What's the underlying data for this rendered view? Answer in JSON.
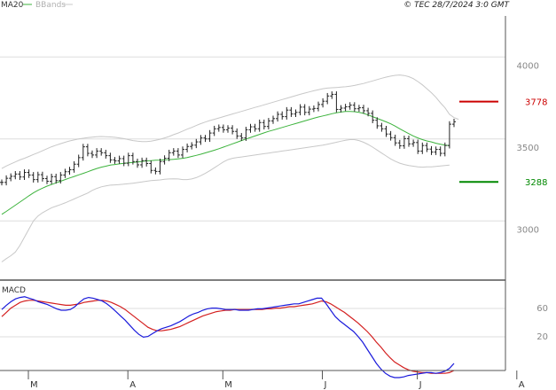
{
  "header": {
    "legend_ma": "MA20",
    "legend_bb": "BBands",
    "copyright": "© TEC 28/7/2024 3:0 GMT"
  },
  "colors": {
    "candle": "#222222",
    "ma20": "#3cb33c",
    "bbands": "#c8c8c8",
    "resistance": "#cc0000",
    "support": "#008800",
    "macd": "#1a1adb",
    "signal": "#d42020",
    "grid": "#dddddd",
    "axis": "#555555"
  },
  "chart_data": [
    {
      "type": "line",
      "title": "",
      "ylim": [
        2700,
        4300
      ],
      "yticks": [
        "4000",
        "3500",
        "3000"
      ],
      "ytick_values": [
        4000,
        3500,
        3000
      ],
      "months": [
        "M",
        "A",
        "M",
        "J",
        "J",
        "A"
      ],
      "month_index": [
        0,
        22,
        43,
        65,
        86,
        108
      ],
      "levels": [
        {
          "name": "resistance",
          "label": "3778",
          "value": 3778
        },
        {
          "name": "support",
          "label": "3288",
          "value": 3288
        }
      ],
      "series": [
        {
          "name": "MA20",
          "values": [
            3090,
            3108,
            3127,
            3146,
            3165,
            3184,
            3203,
            3221,
            3237,
            3250,
            3262,
            3272,
            3282,
            3292,
            3302,
            3312,
            3321,
            3331,
            3340,
            3350,
            3360,
            3370,
            3378,
            3384,
            3390,
            3394,
            3398,
            3401,
            3404,
            3407,
            3410,
            3413,
            3416,
            3418,
            3420,
            3421,
            3423,
            3424,
            3426,
            3428,
            3432,
            3437,
            3443,
            3450,
            3457,
            3465,
            3473,
            3481,
            3490,
            3500,
            3510,
            3520,
            3530,
            3540,
            3550,
            3559,
            3568,
            3578,
            3587,
            3596,
            3604,
            3612,
            3620,
            3628,
            3636,
            3644,
            3652,
            3660,
            3668,
            3676,
            3684,
            3690,
            3697,
            3704,
            3710,
            3714,
            3718,
            3718,
            3716,
            3712,
            3706,
            3696,
            3686,
            3675,
            3665,
            3654,
            3642,
            3628,
            3612,
            3597,
            3582,
            3568,
            3556,
            3546,
            3538,
            3532,
            3524,
            3518,
            3512,
            3510
          ]
        },
        {
          "name": "BBands upper",
          "values": [
            3370,
            3385,
            3398,
            3410,
            3422,
            3432,
            3443,
            3455,
            3466,
            3478,
            3490,
            3502,
            3512,
            3521,
            3530,
            3538,
            3544,
            3550,
            3554,
            3558,
            3561,
            3564,
            3565,
            3564,
            3562,
            3560,
            3556,
            3552,
            3546,
            3540,
            3536,
            3534,
            3534,
            3537,
            3542,
            3548,
            3556,
            3565,
            3576,
            3586,
            3598,
            3610,
            3620,
            3632,
            3643,
            3653,
            3662,
            3670,
            3678,
            3686,
            3694,
            3702,
            3710,
            3718,
            3726,
            3734,
            3742,
            3750,
            3758,
            3766,
            3774,
            3782,
            3790,
            3798,
            3806,
            3814,
            3822,
            3830,
            3837,
            3844,
            3850,
            3856,
            3860,
            3862,
            3864,
            3866,
            3868,
            3872,
            3876,
            3882,
            3888,
            3896,
            3904,
            3912,
            3920,
            3927,
            3933,
            3938,
            3940,
            3937,
            3930,
            3918,
            3900,
            3880,
            3856,
            3832,
            3804,
            3770,
            3740,
            3700,
            3680,
            3670
          ]
        },
        {
          "name": "BBands lower",
          "values": [
            2800,
            2820,
            2838,
            2860,
            2900,
            2950,
            3000,
            3050,
            3080,
            3100,
            3115,
            3130,
            3140,
            3150,
            3160,
            3172,
            3184,
            3196,
            3208,
            3220,
            3236,
            3248,
            3258,
            3264,
            3268,
            3270,
            3272,
            3274,
            3277,
            3280,
            3284,
            3288,
            3292,
            3296,
            3298,
            3300,
            3304,
            3306,
            3307,
            3306,
            3302,
            3302,
            3306,
            3314,
            3326,
            3340,
            3356,
            3374,
            3392,
            3410,
            3424,
            3432,
            3436,
            3440,
            3444,
            3448,
            3452,
            3456,
            3460,
            3464,
            3468,
            3472,
            3476,
            3480,
            3484,
            3488,
            3492,
            3496,
            3500,
            3504,
            3508,
            3512,
            3518,
            3524,
            3530,
            3536,
            3542,
            3546,
            3546,
            3540,
            3530,
            3516,
            3500,
            3482,
            3464,
            3446,
            3428,
            3414,
            3402,
            3394,
            3388,
            3384,
            3380,
            3378,
            3380,
            3380,
            3382,
            3385,
            3388,
            3390
          ]
        },
        {
          "name": "Close",
          "values": [
            3285,
            3310,
            3322,
            3336,
            3318,
            3346,
            3330,
            3302,
            3332,
            3308,
            3292,
            3320,
            3296,
            3330,
            3350,
            3362,
            3396,
            3436,
            3502,
            3462,
            3452,
            3476,
            3466,
            3448,
            3422,
            3416,
            3430,
            3402,
            3448,
            3412,
            3392,
            3418,
            3400,
            3358,
            3352,
            3412,
            3432,
            3466,
            3476,
            3452,
            3486,
            3504,
            3512,
            3532,
            3556,
            3550,
            3586,
            3612,
            3620,
            3606,
            3616,
            3596,
            3568,
            3556,
            3606,
            3624,
            3612,
            3650,
            3626,
            3660,
            3674,
            3700,
            3686,
            3726,
            3702,
            3712,
            3744,
            3712,
            3732,
            3736,
            3760,
            3780,
            3812,
            3822,
            3730,
            3738,
            3746,
            3756,
            3734,
            3740,
            3722,
            3706,
            3664,
            3630,
            3612,
            3580,
            3558,
            3526,
            3508,
            3552,
            3520,
            3528,
            3476,
            3510,
            3488,
            3470,
            3486,
            3462,
            3510,
            3640,
            3655
          ]
        }
      ]
    },
    {
      "type": "line",
      "title": "MACD",
      "ylim": [
        -30,
        95
      ],
      "yticks": [
        "60",
        "20"
      ],
      "ytick_values": [
        60,
        20
      ],
      "series": [
        {
          "name": "MACD",
          "values": [
            56,
            62,
            67,
            71,
            73,
            74,
            72,
            70,
            67,
            65,
            63,
            60,
            57,
            55,
            55,
            56,
            60,
            66,
            71,
            73,
            72,
            70,
            68,
            64,
            59,
            53,
            47,
            41,
            34,
            27,
            21,
            17,
            18,
            22,
            26,
            29,
            31,
            33,
            36,
            39,
            43,
            47,
            50,
            52,
            55,
            57,
            58,
            58,
            57,
            56,
            56,
            56,
            55,
            55,
            55,
            56,
            57,
            57,
            58,
            59,
            60,
            61,
            62,
            63,
            64,
            64,
            66,
            68,
            70,
            72,
            72,
            64,
            55,
            46,
            40,
            35,
            30,
            25,
            18,
            10,
            0,
            -10,
            -20,
            -28,
            -34,
            -38,
            -40,
            -40,
            -39,
            -37,
            -36,
            -35,
            -34,
            -33,
            -33,
            -34,
            -33,
            -31,
            -27,
            -20
          ]
        },
        {
          "name": "Signal",
          "values": [
            46,
            52,
            58,
            62,
            66,
            68,
            69,
            69,
            68,
            67,
            66,
            65,
            64,
            63,
            62,
            62,
            63,
            64,
            66,
            67,
            68,
            69,
            69,
            68,
            66,
            63,
            60,
            56,
            51,
            46,
            41,
            36,
            31,
            28,
            26,
            26,
            27,
            28,
            30,
            32,
            35,
            38,
            41,
            44,
            47,
            49,
            51,
            53,
            54,
            55,
            55,
            56,
            56,
            56,
            56,
            56,
            56,
            56,
            57,
            57,
            58,
            58,
            59,
            60,
            60,
            61,
            62,
            63,
            64,
            66,
            68,
            67,
            64,
            60,
            56,
            52,
            47,
            42,
            37,
            31,
            25,
            18,
            10,
            3,
            -5,
            -12,
            -18,
            -22,
            -26,
            -29,
            -31,
            -32,
            -33,
            -33,
            -34,
            -34,
            -34,
            -34,
            -33,
            -30
          ]
        }
      ]
    }
  ]
}
